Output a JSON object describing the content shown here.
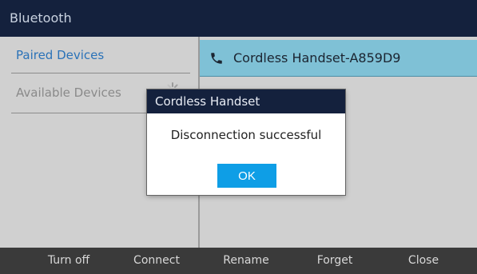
{
  "header": {
    "title": "Bluetooth"
  },
  "sidebar": {
    "items": [
      {
        "label": "Paired Devices",
        "selected": true
      },
      {
        "label": "Available Devices",
        "selected": false
      }
    ]
  },
  "devices": [
    {
      "name": "Cordless Handset-A859D9",
      "icon": "phone-icon"
    }
  ],
  "dialog": {
    "title": "Cordless Handset",
    "message": "Disconnection successful",
    "ok_label": "OK"
  },
  "softkeys": [
    "Turn off",
    "Connect",
    "Rename",
    "Forget",
    "Close"
  ],
  "colors": {
    "titlebar": "#14213d",
    "selected_row": "#7fc1d6",
    "accent_text": "#2a72b8",
    "ok_button": "#0e9ee6",
    "softkey_bar": "#3a3a3a"
  }
}
